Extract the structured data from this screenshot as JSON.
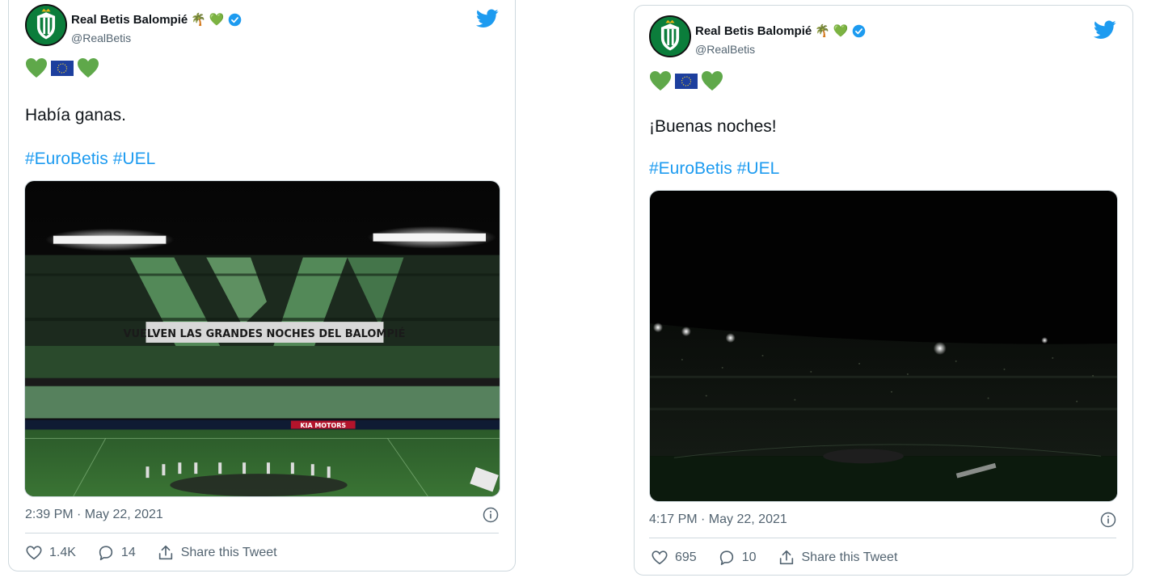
{
  "colors": {
    "accent": "#1d9bf0",
    "text": "#0f1419",
    "muted": "#536471",
    "border": "#cfd9de",
    "heart_green": "#5fa84a",
    "eu_blue": "#1d3f9e"
  },
  "tweets": [
    {
      "author": {
        "display_name": "Real Betis Balompié",
        "name_emojis": [
          "🌴",
          "💚"
        ],
        "handle": "@RealBetis",
        "verified": true
      },
      "emoji_line": [
        "green-heart-icon",
        "eu-flag-icon",
        "green-heart-icon"
      ],
      "text": "Había ganas.",
      "hashtags": [
        "#EuroBetis",
        "#UEL"
      ],
      "media": {
        "banner_text": "VUELVEN LAS GRANDES     NOCHES DEL BALOMPIÉ",
        "ad_text": "KIA MOTORS"
      },
      "timestamp": "2:39 PM · May 22, 2021",
      "likes": "1.4K",
      "replies": "14",
      "share_label": "Share this Tweet"
    },
    {
      "author": {
        "display_name": "Real Betis Balompié",
        "name_emojis": [
          "🌴",
          "💚"
        ],
        "handle": "@RealBetis",
        "verified": true
      },
      "emoji_line": [
        "green-heart-icon",
        "eu-flag-icon",
        "green-heart-icon"
      ],
      "text": "¡Buenas noches!",
      "hashtags": [
        "#EuroBetis",
        "#UEL"
      ],
      "timestamp": "4:17 PM · May 22, 2021",
      "likes": "695",
      "replies": "10",
      "share_label": "Share this Tweet"
    }
  ]
}
